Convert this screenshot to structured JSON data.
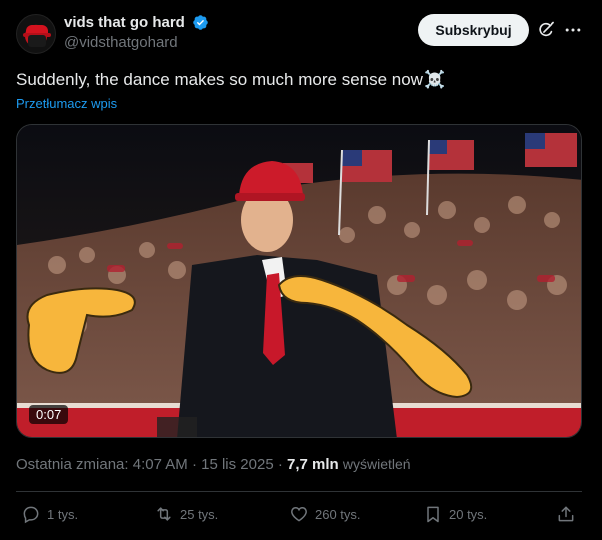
{
  "author": {
    "display_name": "vids that go hard",
    "handle": "@vidsthatgohard",
    "verified": true
  },
  "header": {
    "subscribe_label": "Subskrybuj",
    "grok_icon": "grok-icon",
    "more_icon": "more-icon"
  },
  "tweet": {
    "text": "Suddenly, the dance makes so much more sense now",
    "emoji": "☠️",
    "translate_label": "Przetłumacz wpis"
  },
  "media": {
    "duration": "0:07"
  },
  "meta": {
    "edited_label": "Ostatnia zmiana:",
    "time": "4:07 AM",
    "separator": "·",
    "date": "15 lis 2025",
    "views_count": "7,7 mln",
    "views_label": "wyświetleń"
  },
  "actions": {
    "replies": "1 tys.",
    "reposts": "25 tys.",
    "likes": "260 tys.",
    "bookmarks": "20 tys."
  },
  "colors": {
    "accent": "#1d9bf0",
    "muted": "#71767b",
    "text": "#e7e9ea",
    "background": "#000000"
  }
}
